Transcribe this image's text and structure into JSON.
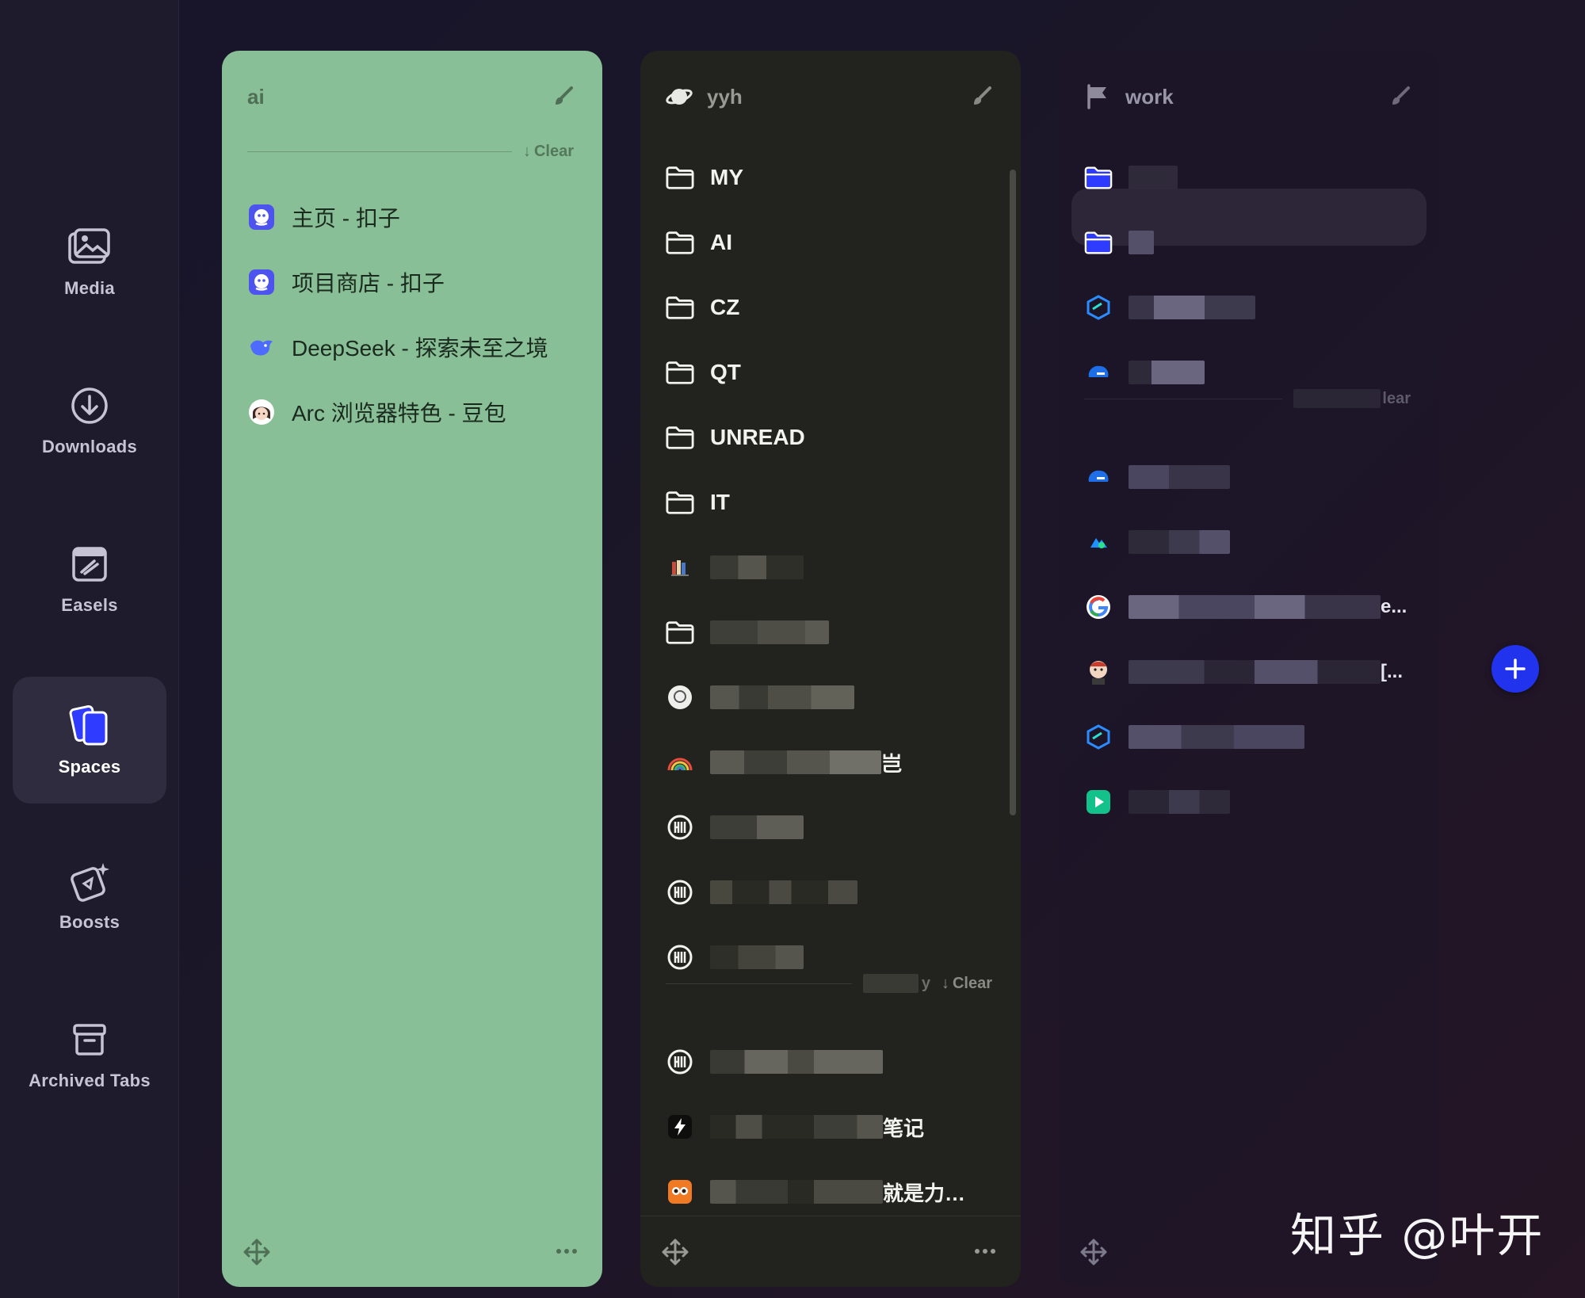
{
  "sidebar": {
    "items": [
      {
        "label": "Media",
        "icon": "media-icon"
      },
      {
        "label": "Downloads",
        "icon": "download-icon"
      },
      {
        "label": "Easels",
        "icon": "easel-icon"
      },
      {
        "label": "Spaces",
        "icon": "spaces-icon",
        "active": true
      },
      {
        "label": "Boosts",
        "icon": "boost-icon"
      },
      {
        "label": "Archived Tabs",
        "icon": "archive-icon"
      }
    ]
  },
  "spaces": {
    "ai": {
      "title": "ai",
      "clear_label": "Clear",
      "tabs": [
        {
          "label": "主页 - 扣子",
          "icon": "coze-icon"
        },
        {
          "label": "项目商店 - 扣子",
          "icon": "coze-icon"
        },
        {
          "label": "DeepSeek - 探索未至之境",
          "icon": "deepseek-icon"
        },
        {
          "label": "Arc 浏览器特色 - 豆包",
          "icon": "doubao-icon"
        }
      ]
    },
    "yyh": {
      "title": "yyh",
      "folders": [
        "MY",
        "AI",
        "CZ",
        "QT",
        "UNREAD",
        "IT"
      ],
      "clear_label": "Clear",
      "partial_texts": {
        "rainbow_suffix": "岂",
        "row_t2_suffix": "笔记",
        "row_t3_suffix": "就是力…",
        "divider_prefix": "y"
      }
    },
    "work": {
      "title": "work",
      "partial_texts": {
        "clear_fragment": "lear",
        "google_suffix": "e...",
        "jenkins_suffix": "[..."
      }
    }
  },
  "add_button_label": "+",
  "watermark": "知乎 @叶开",
  "colors": {
    "ai_space": "#89bf96",
    "yyh_space": "#22221e",
    "accent_blue": "#2233ee"
  }
}
